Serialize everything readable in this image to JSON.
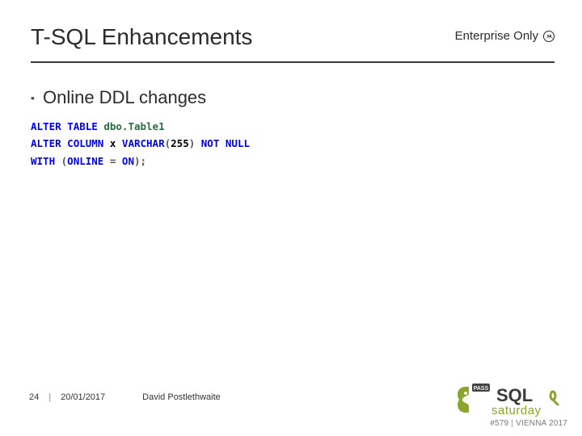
{
  "header": {
    "title": "T-SQL Enhancements",
    "badge_text": "Enterprise Only"
  },
  "bullet": {
    "label": "Online DDL changes"
  },
  "code": {
    "line1_kw1": "ALTER",
    "line1_kw2": "TABLE",
    "line1_table": "dbo.Table1",
    "line2_kw1": "ALTER",
    "line2_kw2": "COLUMN",
    "line2_col": "x",
    "line2_type": "VARCHAR",
    "line2_open": "(",
    "line2_num": "255",
    "line2_close": ")",
    "line2_kw3": "NOT",
    "line2_kw4": "NULL",
    "line3_kw1": "WITH",
    "line3_open": "(",
    "line3_kw2": "ONLINE",
    "line3_eq": "=",
    "line3_kw3": "ON",
    "line3_close": ");"
  },
  "footer": {
    "page_number": "24",
    "separator": "|",
    "date": "20/01/2017",
    "author": "David Postlethwaite",
    "event_number": "#579",
    "event_location": "VIENNA 2017"
  },
  "logo": {
    "pass_text": "PASS",
    "sql_text": "SQL",
    "saturday_text": "saturday"
  },
  "colors": {
    "accent_green": "#8aa52e",
    "dark": "#2b2b2b",
    "code_kw": "#0000ff",
    "code_tbl": "#2a6e3f"
  }
}
